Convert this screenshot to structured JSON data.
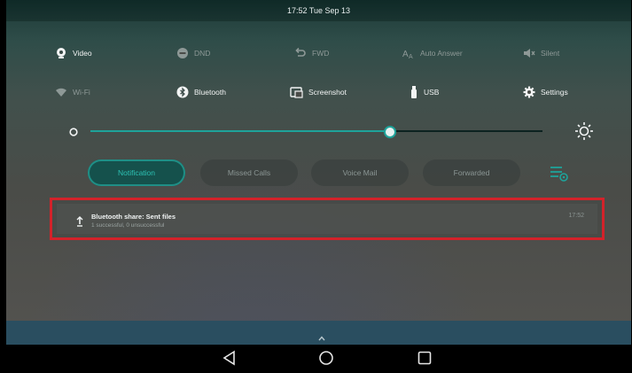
{
  "status_bar": {
    "time_date": "17:52 Tue Sep 13"
  },
  "quick_settings": {
    "row1": [
      {
        "label": "Video",
        "icon": "video-icon",
        "state": "on"
      },
      {
        "label": "DND",
        "icon": "dnd-icon",
        "state": "off"
      },
      {
        "label": "FWD",
        "icon": "forward-icon",
        "state": "off"
      },
      {
        "label": "Auto Answer",
        "icon": "auto-answer-icon",
        "state": "off"
      },
      {
        "label": "Silent",
        "icon": "silent-icon",
        "state": "off"
      }
    ],
    "row2": [
      {
        "label": "Wi-Fi",
        "icon": "wifi-icon",
        "state": "off"
      },
      {
        "label": "Bluetooth",
        "icon": "bluetooth-icon",
        "state": "on"
      },
      {
        "label": "Screenshot",
        "icon": "screenshot-icon",
        "state": "on"
      },
      {
        "label": "USB",
        "icon": "usb-icon",
        "state": "on"
      },
      {
        "label": "Settings",
        "icon": "gear-icon",
        "state": "on"
      }
    ]
  },
  "brightness": {
    "level": 0.66
  },
  "tabs": [
    {
      "label": "Notification",
      "active": true
    },
    {
      "label": "Missed Calls",
      "active": false
    },
    {
      "label": "Voice Mail",
      "active": false
    },
    {
      "label": "Forwarded",
      "active": false
    }
  ],
  "notification": {
    "title": "Bluetooth share: Sent files",
    "subtitle": "1 successful, 0 unsuccessful",
    "time": "17:52",
    "icon": "upload-icon"
  },
  "colors": {
    "accent": "#1ea39a",
    "highlight_border": "#d3222a",
    "pull_bar": "#2a4e60"
  }
}
